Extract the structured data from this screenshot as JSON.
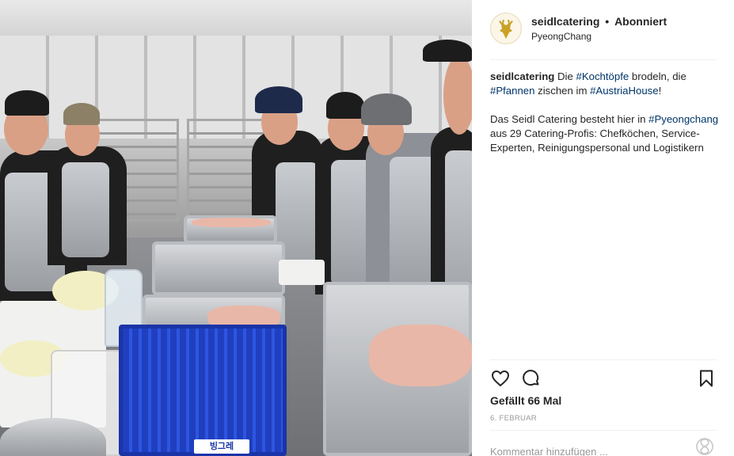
{
  "post": {
    "account": {
      "username": "seidlcatering",
      "separator": "•",
      "follow_status": "Abonniert",
      "location": "PyeongChang"
    },
    "caption": {
      "username": "seidlcatering",
      "line1": [
        {
          "text": " Die ",
          "type": "text"
        },
        {
          "text": "#Kochtöpfe",
          "type": "hashtag"
        },
        {
          "text": " brodeln, die ",
          "type": "text"
        },
        {
          "text": "#Pfannen",
          "type": "hashtag"
        },
        {
          "text": " zischen im ",
          "type": "text"
        },
        {
          "text": "#AustriaHouse",
          "type": "hashtag"
        },
        {
          "text": "!",
          "type": "text"
        }
      ],
      "paragraph2": [
        {
          "text": "Das Seidl Catering besteht hier in ",
          "type": "text"
        },
        {
          "text": "#Pyeongchang",
          "type": "hashtag"
        },
        {
          "text": " aus 29 Catering-Profis: Chefköchen, Service-Experten, Reinigungspersonal und Logistikern",
          "type": "text"
        }
      ]
    },
    "likes_text": "Gefällt 66 Mal",
    "date_text": "6. FEBRUAR",
    "comment": {
      "placeholder": "Kommentar hinzufügen ...",
      "value": ""
    },
    "photo": {
      "crate_text": "빙그레"
    },
    "icons": {
      "avatar": "deer-logo-icon",
      "like": "heart-icon",
      "comment": "comment-bubble-icon",
      "save": "bookmark-icon",
      "loading": "spinner-icon"
    },
    "colors": {
      "hashtag": "#003569",
      "text": "#262626",
      "muted": "#999999",
      "divider": "#efefef",
      "logo_gold": "#c9a227"
    }
  }
}
